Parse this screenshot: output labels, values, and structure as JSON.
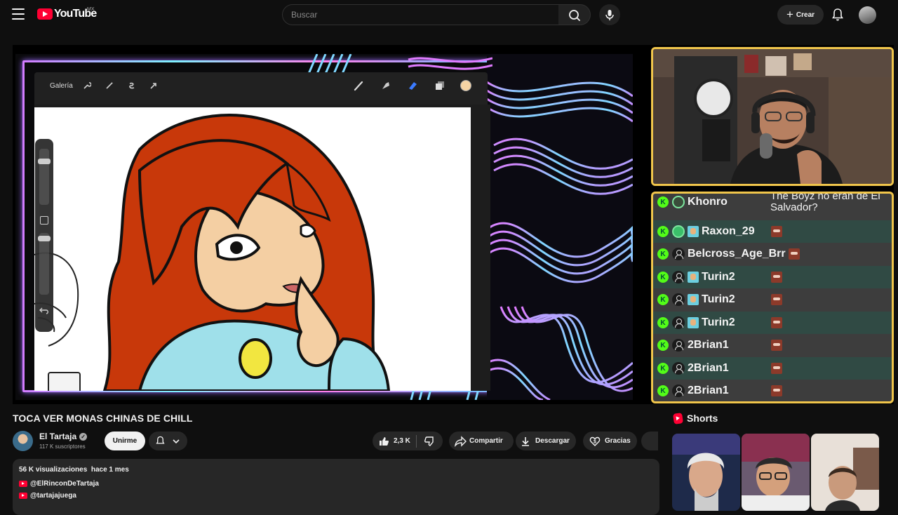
{
  "header": {
    "logo_text": "YouTube",
    "country_code": "MX",
    "search_placeholder": "Buscar",
    "create_label": "Crear"
  },
  "player": {
    "app_toolbar_label": "Galería",
    "chat": [
      {
        "user": "Khonro",
        "message": "The Boyz no eran de El Salvador?"
      },
      {
        "user": "Raxon_29"
      },
      {
        "user": "Belcross_Age_Brr"
      },
      {
        "user": "Turin2"
      },
      {
        "user": "Turin2"
      },
      {
        "user": "Turin2"
      },
      {
        "user": "2Brian1"
      },
      {
        "user": "2Brian1"
      },
      {
        "user": "2Brian1"
      }
    ]
  },
  "video": {
    "title": "TOCA VER MONAS CHINAS DE CHILL",
    "channel_name": "El Tartaja",
    "subscribers": "117 K suscriptores",
    "join_label": "Unirme",
    "likes": "2,3 K",
    "share_label": "Compartir",
    "download_label": "Descargar",
    "thanks_label": "Gracias"
  },
  "description": {
    "views": "56 K visualizaciones",
    "date": "hace 1 mes",
    "links": [
      "@ElRinconDeTartaja",
      "@tartajajuega"
    ]
  },
  "sidebar": {
    "shorts_title": "Shorts"
  },
  "colors": {
    "brand_red": "#ff0033",
    "stream_frame": "#f0c54b",
    "kick_green": "#53fc18",
    "hair": "#c8380a"
  }
}
